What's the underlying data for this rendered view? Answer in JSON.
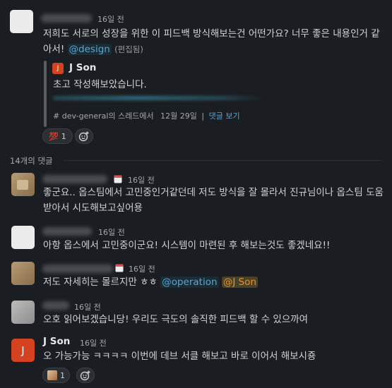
{
  "parent": {
    "time": "16일 전",
    "text": "저희도 서로의 성장을 위한 이 피드백 방식해보는건 어떤가요? 너무 좋은 내용인거 같아서! ",
    "mention": "@design",
    "edited": "(편집됨)",
    "quote": {
      "avatar_letter": "J",
      "author": "J Son",
      "text": "초고 작성해보았습니다.",
      "footer": "# dev-general의 스레드에서",
      "date": "12월 29일",
      "separator": "|",
      "view_reply": "댓글 보기"
    },
    "reaction": {
      "emoji": "💯",
      "count": "1"
    }
  },
  "replies_count_label": "14개의 댓글",
  "replies": [
    {
      "time": "16일 전",
      "text": "좋군요.. 옵스팀에서 고민중인거같던데 저도 방식을 잘 몰라서 진규님이나 옵스팀 도움받아서 시도해보고싶어용"
    },
    {
      "time": "16일 전",
      "text": "아항 옵스에서 고민중이군요! 시스템이 마련된 후 해보는것도 좋겠네요!!"
    },
    {
      "time": "16일 전",
      "text": "저도 자세히는 몰르지만 ㅎㅎ ",
      "mention1": "@operation",
      "mention2": "@J Son"
    },
    {
      "time": "16일 전",
      "text": "오호 읽어보겠습니당! 우리도 극도의 솔직한 피드백 할 수 있으까여"
    },
    {
      "avatar_letter": "J",
      "author": "J Son",
      "time": "16일 전",
      "text": "오 가능가능 ㅋㅋㅋㅋ 이번에 데브 서클 해보고 바로 이어서 해보시죵",
      "reaction_count": "1"
    }
  ],
  "colors": {
    "background": "#1a1d21",
    "mention": "#58a6d3",
    "highlight_mention": "#e8912d",
    "j_avatar": "#d4431f"
  }
}
